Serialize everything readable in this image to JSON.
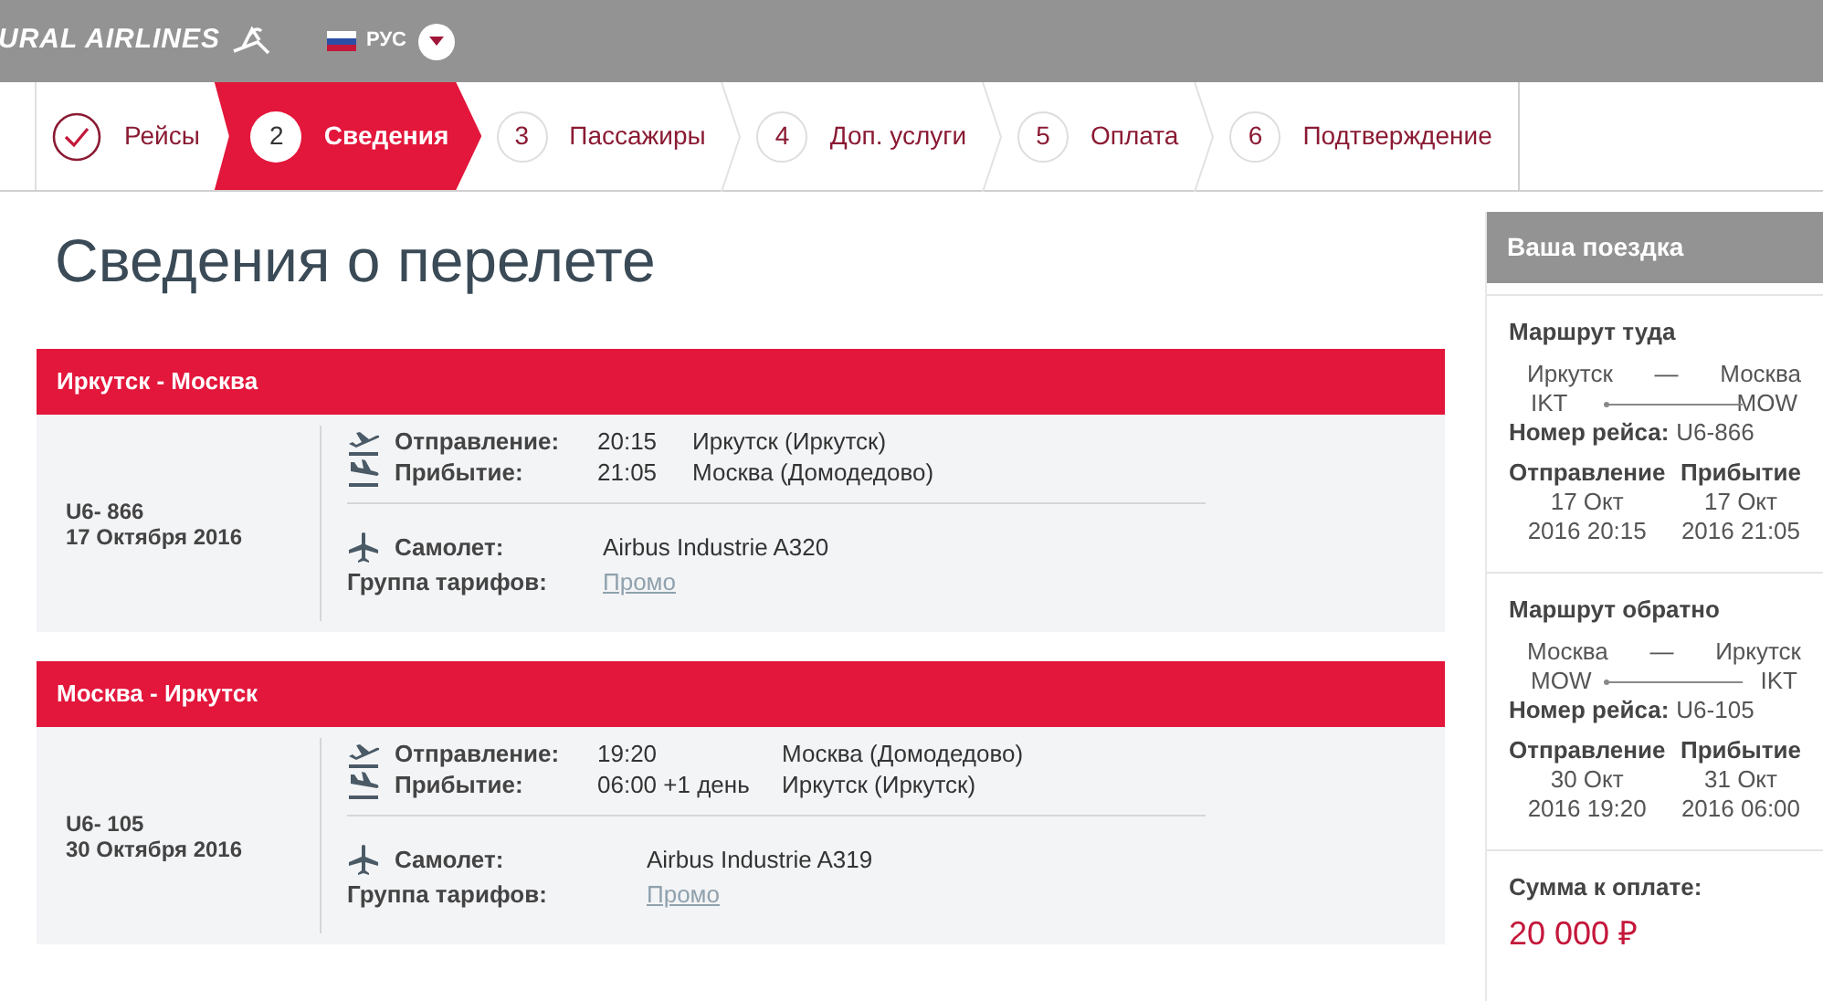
{
  "header": {
    "logo": "URAL AIRLINES",
    "language": "РУС"
  },
  "steps": [
    {
      "label": "Рейсы",
      "done": true,
      "selected": false
    },
    {
      "number": "2",
      "label": "Сведения",
      "done": false,
      "selected": true
    },
    {
      "number": "3",
      "label": "Пассажиры",
      "done": false,
      "selected": false
    },
    {
      "number": "4",
      "label": "Доп. услуги",
      "done": false,
      "selected": false
    },
    {
      "number": "5",
      "label": "Оплата",
      "done": false,
      "selected": false
    },
    {
      "number": "6",
      "label": "Подтверждение",
      "done": false,
      "selected": false
    }
  ],
  "title": "Сведения о перелете",
  "segments": [
    {
      "route": "Иркутск - Москва",
      "flight": "U6- 866",
      "date": "17 Октября 2016",
      "departure_label": "Отправление:",
      "departure_time": "20:15",
      "departure_place": "Иркутск (Иркутск)",
      "arrival_label": "Прибытие:",
      "arrival_time": "21:05",
      "arrival_place": "Москва (Домодедово)",
      "aircraft_label": "Самолет:",
      "aircraft": "Airbus Industrie A320",
      "fare_label": "Группа тарифов:",
      "fare": "Промо"
    },
    {
      "route": "Москва - Иркутск",
      "flight": "U6- 105",
      "date": "30 Октября 2016",
      "departure_label": "Отправление:",
      "departure_time": "19:20",
      "departure_place": "Москва (Домодедово)",
      "arrival_label": "Прибытие:",
      "arrival_time": "06:00 +1 день",
      "arrival_place": "Иркутск (Иркутск)",
      "aircraft_label": "Самолет:",
      "aircraft": "Airbus Industrie A319",
      "fare_label": "Группа тарифов:",
      "fare": "Промо"
    }
  ],
  "sidebar": {
    "title": "Ваша поездка",
    "routes": [
      {
        "heading": "Маршрут туда",
        "from_city": "Иркутск",
        "dash": "—",
        "to_city": "Москва",
        "from_code": "IKT",
        "to_code": "MOW",
        "flight_label": "Номер рейса:",
        "flight": "U6-866",
        "departure_label": "Отправление",
        "departure_date": "17 Окт",
        "departure_time": "2016 20:15",
        "arrival_label": "Прибытие",
        "arrival_date": "17 Окт",
        "arrival_time": "2016 21:05"
      },
      {
        "heading": "Маршрут обратно",
        "from_city": "Москва",
        "dash": "—",
        "to_city": "Иркутск",
        "from_code": "MOW",
        "to_code": "IKT",
        "flight_label": "Номер рейса:",
        "flight": "U6-105",
        "departure_label": "Отправление",
        "departure_date": "30 Окт",
        "departure_time": "2016 19:20",
        "arrival_label": "Прибытие",
        "arrival_date": "31 Окт",
        "arrival_time": "2016 06:00"
      }
    ],
    "total_label": "Сумма к оплате:",
    "total": "20 000 ₽"
  }
}
